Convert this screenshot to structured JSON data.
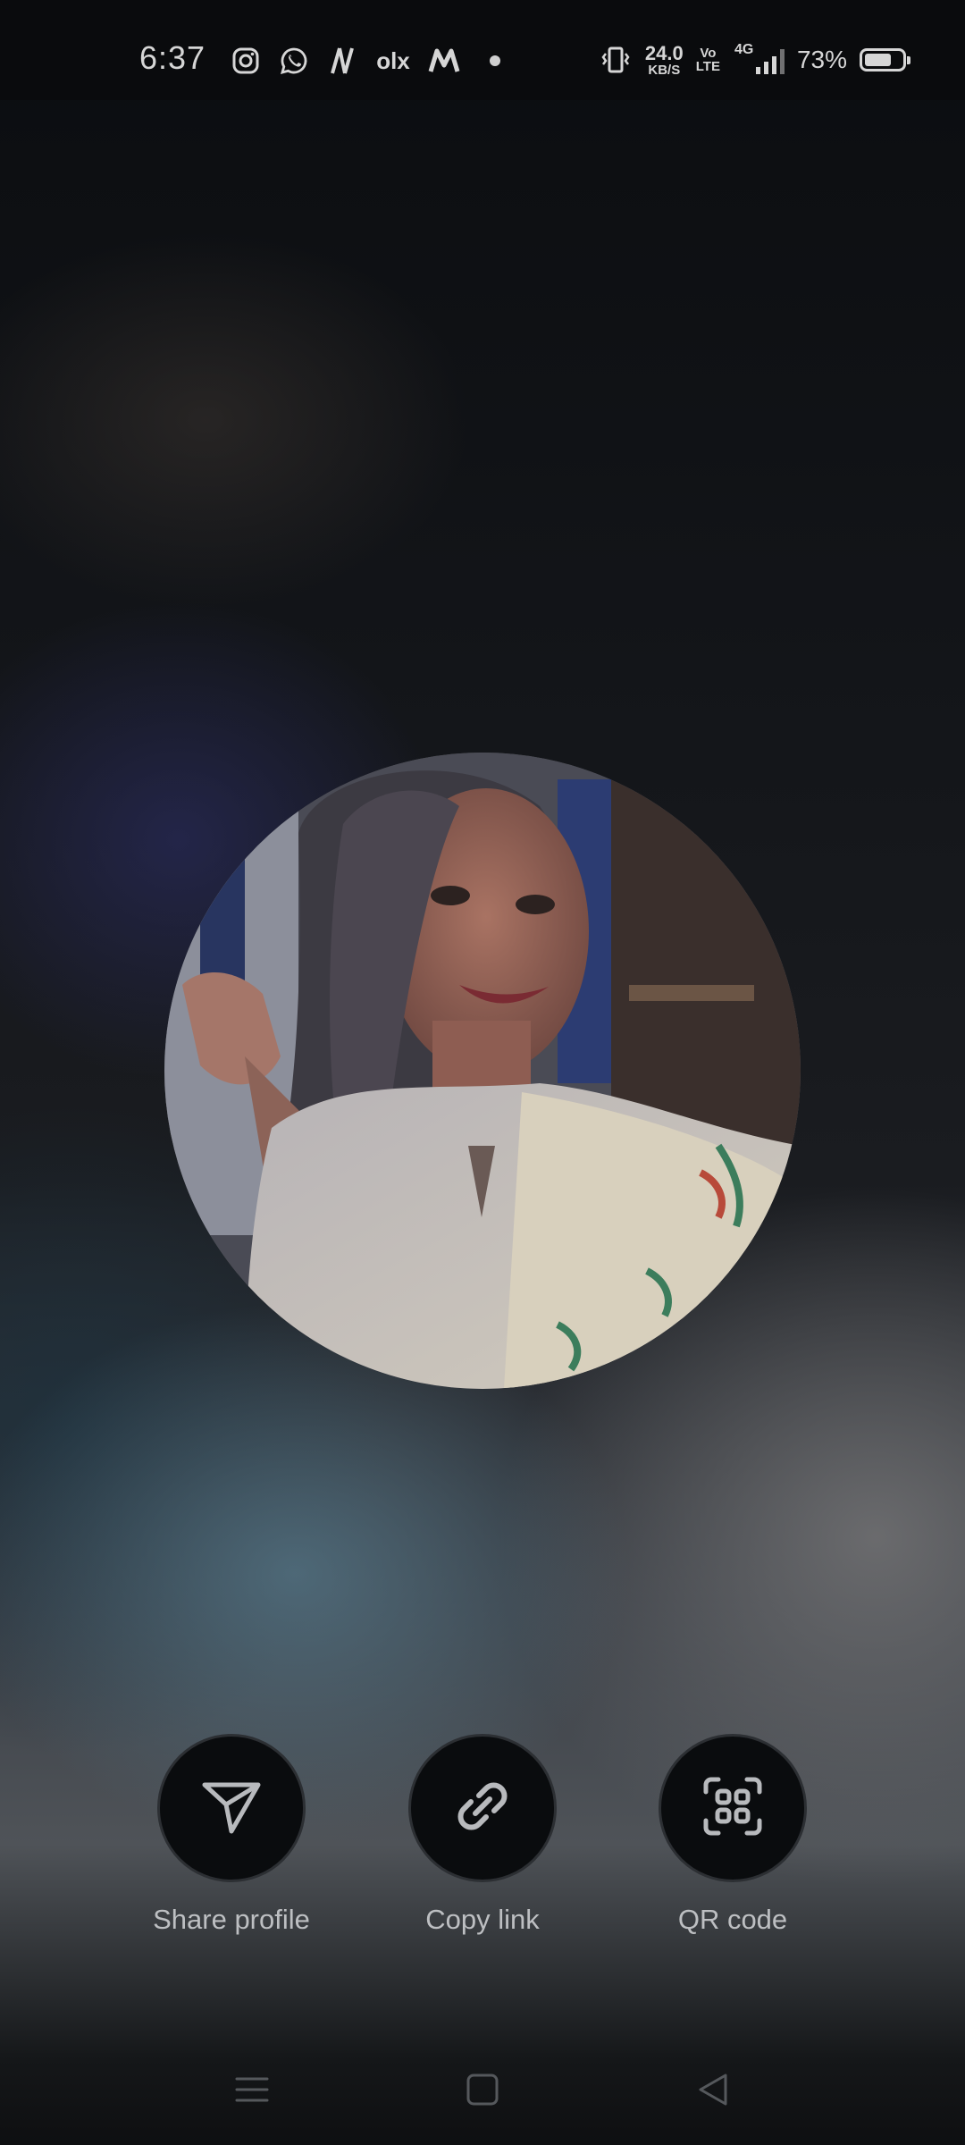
{
  "status_bar": {
    "time": "6:37",
    "notification_icons": [
      "instagram-icon",
      "whatsapp-icon",
      "n-app-icon",
      "olx-icon",
      "m-app-icon",
      "more-dot-icon"
    ],
    "olx_text": "olx",
    "vibrate_icon": "vibrate-icon",
    "net_speed_value": "24.0",
    "net_speed_unit": "KB/S",
    "volte_top": "Vo",
    "volte_bottom": "LTE",
    "network_type": "4G",
    "battery_percent": "73%",
    "battery_level": 0.73
  },
  "profile": {
    "avatar_icon": "profile-photo"
  },
  "actions": [
    {
      "label": "Share profile",
      "icon": "send-icon"
    },
    {
      "label": "Copy link",
      "icon": "link-icon"
    },
    {
      "label": "QR code",
      "icon": "qr-scan-icon"
    }
  ],
  "nav_bar": {
    "buttons": [
      "menu-icon",
      "home-icon",
      "back-icon"
    ]
  },
  "colors": {
    "status_text": "#d6d6d6",
    "button_bg": "#0a0c0e",
    "label_text": "#bdbfc2"
  }
}
